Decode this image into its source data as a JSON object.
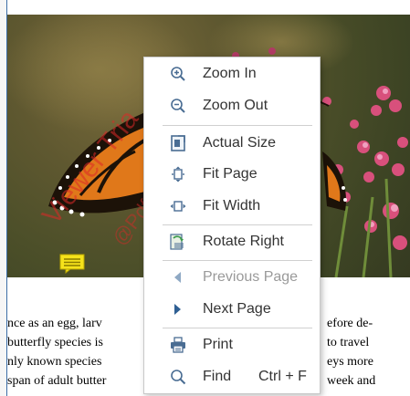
{
  "page_text": {
    "lines": [
      {
        "left": "nce as an egg, larv",
        "right": "efore de-"
      },
      {
        "left": "butterfly species is",
        "right": "to travel"
      },
      {
        "left": "nly known species",
        "right": "eys more"
      },
      {
        "left": "span of adult butter",
        "right": "week and"
      }
    ]
  },
  "watermark": {
    "line1": "Viewer Tria",
    "line2": "@Pdfsh"
  },
  "context_menu": {
    "items": [
      {
        "label": "Zoom In",
        "icon": "zoom-in-icon",
        "enabled": true
      },
      {
        "label": "Zoom Out",
        "icon": "zoom-out-icon",
        "enabled": true
      },
      {
        "label": "Actual Size",
        "icon": "actual-size-icon",
        "enabled": true
      },
      {
        "label": "Fit Page",
        "icon": "fit-page-icon",
        "enabled": true
      },
      {
        "label": "Fit Width",
        "icon": "fit-width-icon",
        "enabled": true
      },
      {
        "label": "Rotate Right",
        "icon": "rotate-right-icon",
        "enabled": true
      },
      {
        "label": "Previous Page",
        "icon": "previous-page-icon",
        "enabled": false
      },
      {
        "label": "Next Page",
        "icon": "next-page-icon",
        "enabled": true
      },
      {
        "label": "Print",
        "icon": "printer-icon",
        "enabled": true
      },
      {
        "label": "Find",
        "icon": "search-icon",
        "enabled": true,
        "shortcut": "Ctrl + F"
      }
    ]
  },
  "colors": {
    "accent": "#3c6ea8",
    "icon": "#4a6d93",
    "note": "#f5e21b",
    "watermark": "#dc2828"
  }
}
